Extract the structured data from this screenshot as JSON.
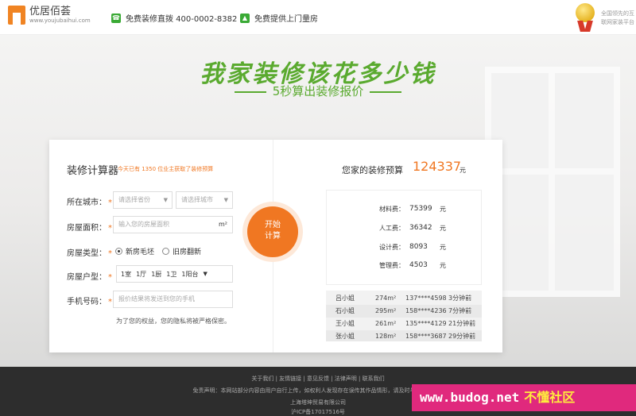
{
  "header": {
    "logo_cn": "优居佰荟",
    "logo_en": "www.youjubaihui.com",
    "hotline": "免费装修直拨 400-0002-8382",
    "measure": "免费提供上门量房",
    "slogan_line1": "全国领先的互",
    "slogan_line2": "联网家装平台"
  },
  "hero": {
    "headline": "我家装修该花多少钱",
    "subline": "5秒算出装修报价"
  },
  "calculator": {
    "title": "装修计算器",
    "tip": "今天已有 1350 位业主获取了装修预算",
    "city_label": "所在城市：",
    "province_placeholder": "请选择省份",
    "city_placeholder": "请选择城市",
    "area_label": "房屋面积：",
    "area_placeholder": "输入您的房屋面积",
    "area_unit": "m²",
    "type_label": "房屋类型：",
    "type_new": "新房毛坯",
    "type_old": "旧房翻新",
    "layout_label": "房屋户型：",
    "layout": [
      "1室",
      "1厅",
      "1厨",
      "1卫",
      "1阳台"
    ],
    "phone_label": "手机号码：",
    "phone_placeholder": "报价结果将发送到您的手机",
    "privacy": "为了您的权益，您的隐私将被严格保密。",
    "button_line1": "开始",
    "button_line2": "计算"
  },
  "budget": {
    "title": "您家的装修预算",
    "total": "124337",
    "unit": "元",
    "items": [
      {
        "label": "材料费：",
        "value": "75399",
        "unit": "元"
      },
      {
        "label": "人工费：",
        "value": "36342",
        "unit": "元"
      },
      {
        "label": "设计费：",
        "value": "8093",
        "unit": "元"
      },
      {
        "label": "管理费：",
        "value": "4503",
        "unit": "元"
      }
    ],
    "recent": [
      {
        "name": "吕小姐",
        "area": "274m²",
        "phone": "137****4598",
        "time": "3分钟前"
      },
      {
        "name": "石小姐",
        "area": "295m²",
        "phone": "158****4236",
        "time": "7分钟前"
      },
      {
        "name": "王小姐",
        "area": "261m²",
        "phone": "135****4129",
        "time": "21分钟前"
      },
      {
        "name": "张小姐",
        "area": "128m²",
        "phone": "158****3687",
        "time": "29分钟前"
      }
    ]
  },
  "footer": {
    "links": "关于我们 | 友情链接 | 意见反馈 | 法律声明 | 联系我们",
    "disclaimer": "免责声明：本网站部分内容由用户自行上传，如权利人发现存在误传其作品情形，请及时与本站联系。",
    "company": "上海塔坤贸易有限公司",
    "icp": "沪ICP备17017516号"
  },
  "watermark": {
    "url": "www.budog.net",
    "cn": "不懂社区"
  }
}
